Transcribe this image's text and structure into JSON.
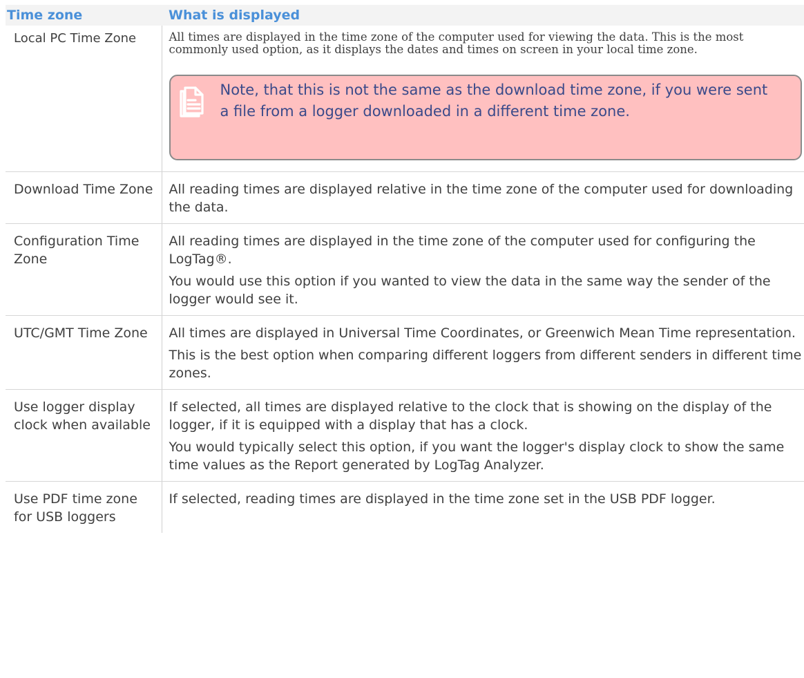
{
  "table": {
    "headers": {
      "zone": "Time zone",
      "display": "What is displayed"
    },
    "rows": [
      {
        "zone": "Local PC Time Zone",
        "paragraphs": [
          "All times are displayed in the time zone of the computer used for viewing the data. This is the most commonly used option, as it displays the dates and times on screen in your local time zone."
        ],
        "note": "Note, that this is not the same as the download time zone, if you were sent a file from a logger downloaded in a different time zone."
      },
      {
        "zone": "Download Time Zone",
        "paragraphs": [
          "All reading times are displayed relative in the time zone of the computer used for downloading the data."
        ]
      },
      {
        "zone": "Configuration Time Zone",
        "paragraphs": [
          "All reading times are displayed in the time zone of the computer used for configuring the LogTag®.",
          "You would use this option if you wanted to view the data in the same way the sender of the logger would see it."
        ]
      },
      {
        "zone": "UTC/GMT Time Zone",
        "paragraphs": [
          "All times are displayed in Universal Time Coordinates, or Greenwich Mean Time representation.",
          "This is the best option when comparing different loggers from different senders in different time zones."
        ]
      },
      {
        "zone": "Use logger display clock when available",
        "paragraphs": [
          "If selected, all times are displayed relative to the clock that is showing on the display of the logger, if it is equipped with a display that has a clock.",
          "You would typically select this option, if you want the logger's display clock to show the same time values as the Report generated by LogTag Analyzer."
        ]
      },
      {
        "zone": "Use PDF time zone for USB loggers",
        "paragraphs": [
          "If selected, reading times are displayed in the time zone set in the USB PDF logger."
        ]
      }
    ]
  },
  "icons": {
    "note": "document-note-icon"
  },
  "colors": {
    "header_text": "#4a90d9",
    "header_bg": "#f3f3f3",
    "note_bg": "#ffc0c0",
    "note_text": "#3a4a8a",
    "note_icon": "#ffffff"
  }
}
